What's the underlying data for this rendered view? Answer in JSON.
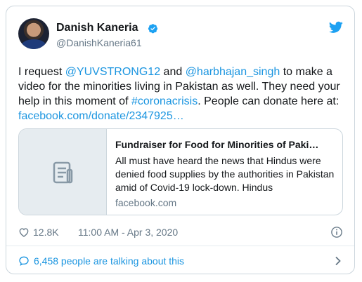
{
  "author": {
    "name": "Danish Kaneria",
    "handle": "@DanishKaneria61",
    "verified": true,
    "avatar_icon": "user-avatar"
  },
  "tweet": {
    "text_parts": {
      "p1": "I request ",
      "mention1": "@YUVSTRONG12",
      "p2": " and ",
      "mention2": "@harbhajan_singh",
      "p3": " to make a video for the minorities living in Pakistan as well. They need your help in this moment of ",
      "hashtag": "#coronacrisis",
      "p4": ". People can donate here at: ",
      "link": "facebook.com/donate/2347925…"
    }
  },
  "link_card": {
    "thumb_icon": "document-icon",
    "title": "Fundraiser for Food for Minorities of Paki…",
    "description": "All must have heard the news that Hindus were denied food supplies by the authorities in Pakistan amid of Covid-19 lock-down. Hindus",
    "domain": "facebook.com"
  },
  "meta": {
    "likes": "12.8K",
    "timestamp": "11:00 AM - Apr 3, 2020"
  },
  "footer": {
    "talking": "6,458 people are talking about this"
  },
  "colors": {
    "link": "#1b95e0",
    "muted": "#657786",
    "border": "#ccd6dd",
    "text": "#14171a"
  }
}
